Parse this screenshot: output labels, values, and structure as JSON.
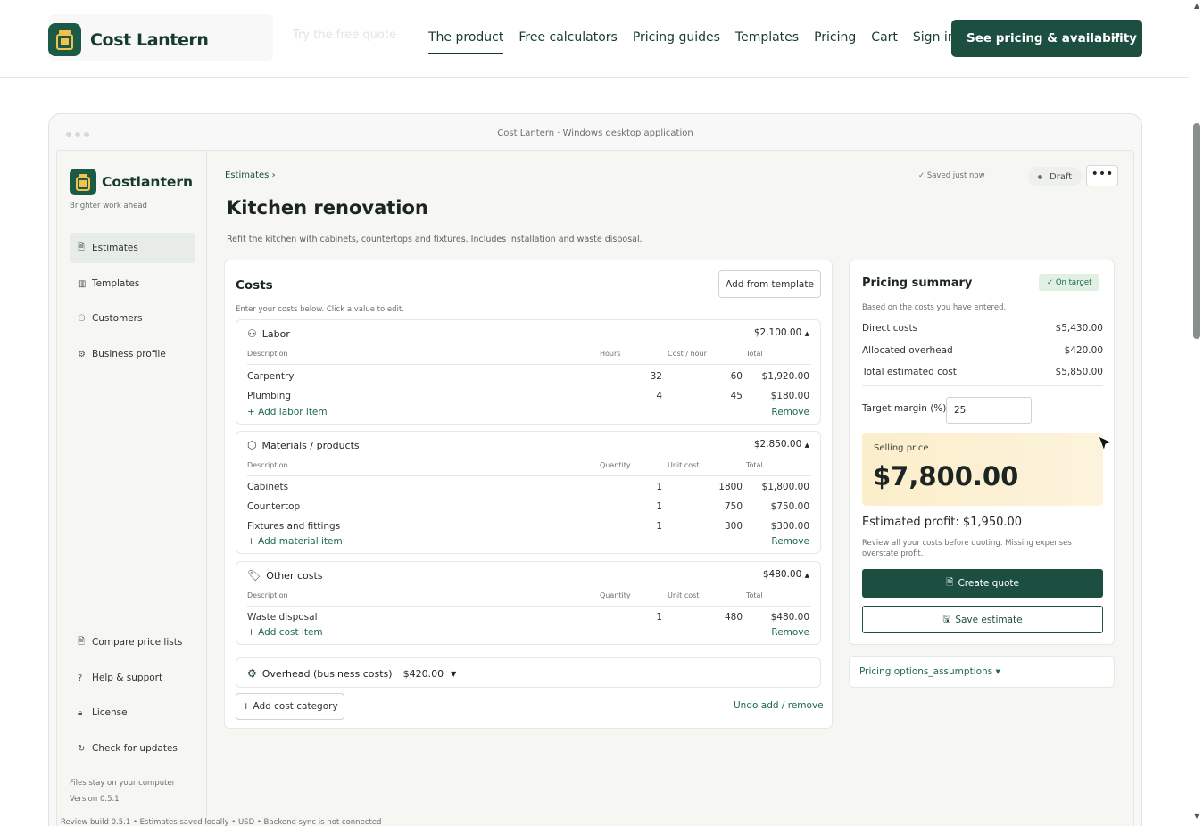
{
  "site": {
    "brand": "Cost Lantern",
    "nav": [
      "The product",
      "Free calculators",
      "Pricing guides",
      "Templates",
      "Pricing",
      "Cart",
      "Sign in"
    ],
    "cta": "See pricing & availability",
    "ghost_text": "Try the free quote"
  },
  "window": {
    "title": "Cost Lantern · Windows desktop application"
  },
  "sidebar": {
    "brand": "Costlantern",
    "tagline": "Brighter work ahead",
    "items": [
      {
        "label": "Estimates",
        "icon": "document-icon"
      },
      {
        "label": "Templates",
        "icon": "columns-icon"
      },
      {
        "label": "Customers",
        "icon": "users-icon"
      },
      {
        "label": "Business profile",
        "icon": "gear-icon"
      }
    ],
    "bottom_items": [
      {
        "label": "Compare price lists",
        "icon": "document-icon"
      },
      {
        "label": "Help & support",
        "icon": "help-icon"
      },
      {
        "label": "License",
        "icon": "lock-icon"
      },
      {
        "label": "Check for updates",
        "icon": "refresh-icon"
      }
    ],
    "footer_note": "Files stay on your computer",
    "version": "Version 0.5.1"
  },
  "status_bar": "Review build 0.5.1 • Estimates saved locally • USD • Backend sync is not connected",
  "estimate": {
    "breadcrumb": "Estimates",
    "saved": "✓ Saved just now",
    "status": "Draft",
    "more": "•••",
    "title": "Kitchen renovation",
    "description": "Refit the kitchen with cabinets, countertops and fixtures. Includes installation and waste disposal."
  },
  "costs": {
    "heading": "Costs",
    "add_template": "Add from template",
    "hint": "Enter your costs below. Click a value to edit.",
    "groups": [
      {
        "name": "Labor",
        "icon": "users-icon",
        "total": "$2,100.00",
        "columns": [
          "Description",
          "Hours",
          "Cost / hour",
          "Total"
        ],
        "rows": [
          {
            "desc": "Carpentry",
            "qty": "32",
            "unit": "60",
            "total": "$1,920.00"
          },
          {
            "desc": "Plumbing",
            "qty": "4",
            "unit": "45",
            "total": "$180.00"
          }
        ],
        "add": "+ Add labor item",
        "remove": "Remove"
      },
      {
        "name": "Materials / products",
        "icon": "box-icon",
        "total": "$2,850.00",
        "columns": [
          "Description",
          "Quantity",
          "Unit cost",
          "Total"
        ],
        "rows": [
          {
            "desc": "Cabinets",
            "qty": "1",
            "unit": "1800",
            "total": "$1,800.00"
          },
          {
            "desc": "Countertop",
            "qty": "1",
            "unit": "750",
            "total": "$750.00"
          },
          {
            "desc": "Fixtures and fittings",
            "qty": "1",
            "unit": "300",
            "total": "$300.00"
          }
        ],
        "add": "+ Add material item",
        "remove": "Remove"
      },
      {
        "name": "Other costs",
        "icon": "tag-icon",
        "total": "$480.00",
        "columns": [
          "Description",
          "Quantity",
          "Unit cost",
          "Total"
        ],
        "rows": [
          {
            "desc": "Waste disposal",
            "qty": "1",
            "unit": "480",
            "total": "$480.00"
          }
        ],
        "add": "+ Add cost item",
        "remove": "Remove"
      }
    ],
    "overhead_label": "Overhead (business costs)",
    "overhead_value": "$420.00",
    "add_category": "+ Add cost category",
    "undo": "Undo add / remove"
  },
  "summary": {
    "heading": "Pricing summary",
    "badge": "✓ On target",
    "note": "Based on the costs you have entered.",
    "rows": [
      {
        "label": "Direct costs",
        "value": "$5,430.00"
      },
      {
        "label": "Allocated overhead",
        "value": "$420.00"
      },
      {
        "label": "Total estimated cost",
        "value": "$5,850.00"
      }
    ],
    "margin_label": "Target margin (%)",
    "margin_value": "25",
    "price_label": "Selling price",
    "price_value": "$7,800.00",
    "profit": "Estimated profit: $1,950.00",
    "review": "Review all your costs before quoting. Missing expenses overstate profit.",
    "create": "Create quote",
    "save": "Save estimate",
    "options": "Pricing options_assumptions ▾"
  },
  "colors": {
    "brand": "#1d4f40",
    "accent_bg": "#fbeeca",
    "badge_bg": "#e1f0e2"
  }
}
